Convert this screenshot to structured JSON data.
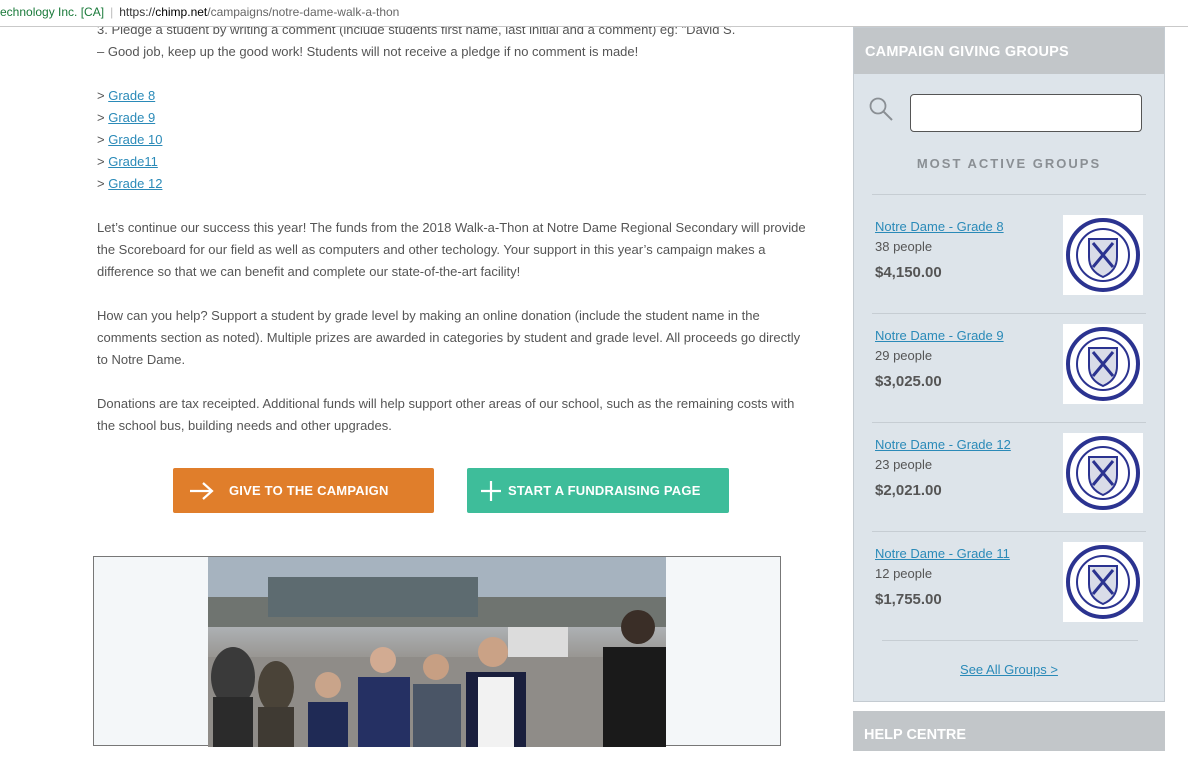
{
  "urlbar": {
    "security": "echnology Inc. [CA]",
    "protocol": "https://",
    "host": "chimp.net",
    "path": "/campaigns/notre-dame-walk-a-thon"
  },
  "main": {
    "clipped_line": "3. Pledge a student by writing a comment (include students first name, last initial and a comment) eg: \"David S.",
    "line2": "– Good job, keep up the good work! Students will not receive a pledge if no comment is made!",
    "grades": [
      "Grade 8",
      "Grade 9",
      "Grade 10",
      "Grade11",
      "Grade 12"
    ],
    "p1": "Let’s continue our success this year! The funds from the 2018 Walk-a-Thon at Notre Dame Regional Secondary will provide the Scoreboard for our field as well as computers and other techology. Your support in this year’s campaign makes a difference so that we can benefit and complete our state-of-the-art facility!",
    "p2": "How can you help? Support a student by grade level by making an online donation (include the student name in the comments section as noted). Multiple prizes are awarded in categories by student and grade level. All proceeds go directly to Notre Dame.",
    "p3": "Donations are tax receipted. Additional funds will help support other areas of our school, such as the remaining costs with the school bus, building needs and other upgrades.",
    "give_label": "GIVE TO THE CAMPAIGN",
    "start_label": "START A FUNDRAISING PAGE"
  },
  "sidebar": {
    "title": "CAMPAIGN GIVING GROUPS",
    "search_placeholder": "",
    "most_active": "MOST ACTIVE GROUPS",
    "groups": [
      {
        "name": "Notre Dame - Grade 8",
        "people": "38 people",
        "amount": "$4,150.00"
      },
      {
        "name": "Notre Dame - Grade 9",
        "people": "29 people",
        "amount": "$3,025.00"
      },
      {
        "name": "Notre Dame - Grade 12",
        "people": "23 people",
        "amount": "$2,021.00"
      },
      {
        "name": "Notre Dame - Grade 11",
        "people": "12 people",
        "amount": "$1,755.00"
      }
    ],
    "see_all": "See All Groups >",
    "crest_text": "Notre Dame"
  },
  "help": {
    "title": "HELP CENTRE"
  },
  "colors": {
    "give": "#e07e2b",
    "start": "#3ebd9a",
    "link": "#2a8ab8",
    "crest": "#2b3390"
  }
}
